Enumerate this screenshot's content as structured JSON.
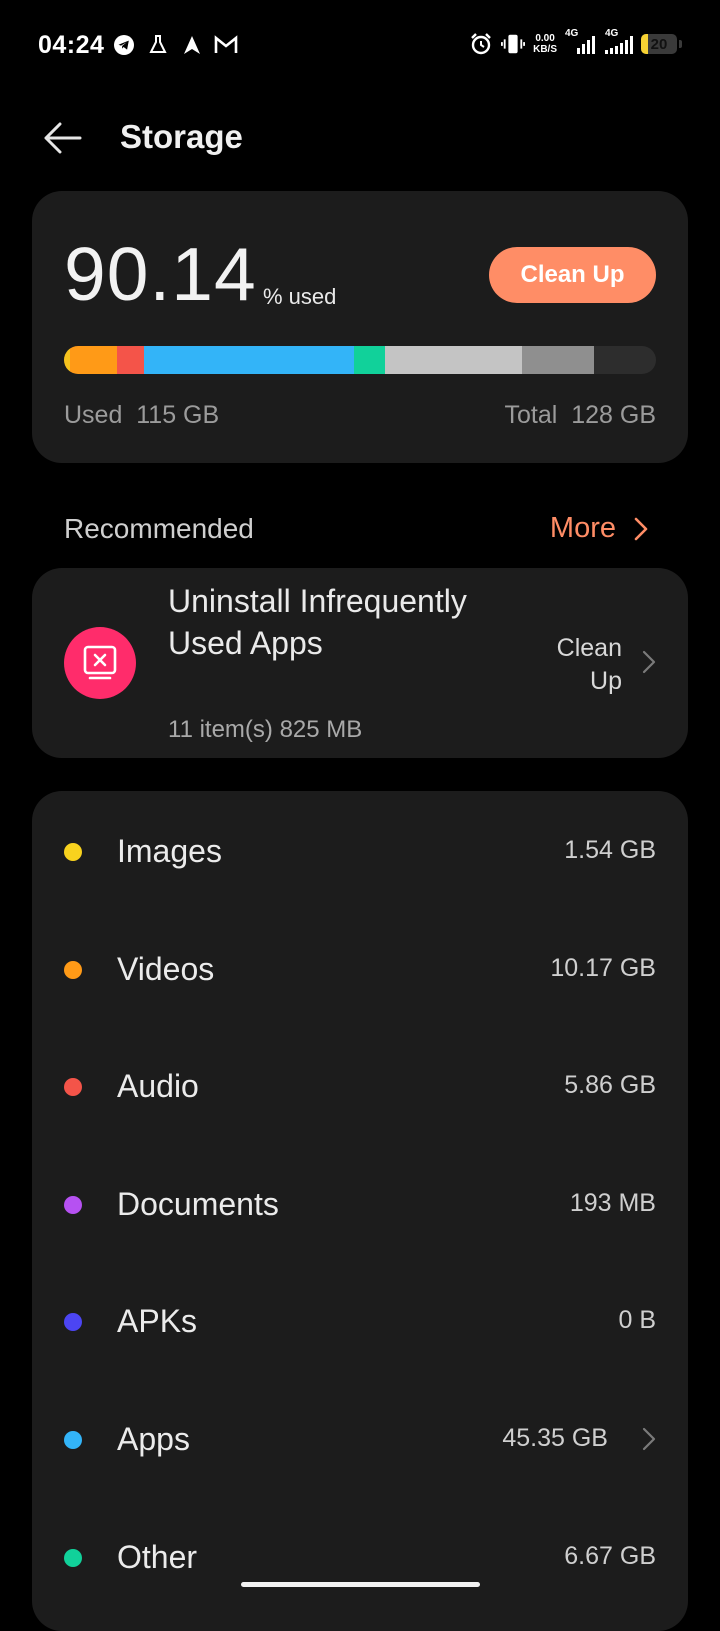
{
  "status_bar": {
    "time": "04:24",
    "net_speed_value": "0.00",
    "net_speed_unit": "KB/S",
    "sim1_label": "4G",
    "sim2_label": "4G",
    "battery_level": "20"
  },
  "header": {
    "title": "Storage"
  },
  "usage": {
    "percent": "90.14",
    "percent_label": "% used",
    "clean_up_label": "Clean Up",
    "used_label": "Used  115 GB",
    "total_label": "Total  128 GB",
    "bar_segments": [
      {
        "name": "images",
        "color": "#f6c21d",
        "fraction": 0.01
      },
      {
        "name": "videos",
        "color": "#ff9a17",
        "fraction": 0.08
      },
      {
        "name": "audio",
        "color": "#f45449",
        "fraction": 0.046
      },
      {
        "name": "apps",
        "color": "#33b4f8",
        "fraction": 0.354
      },
      {
        "name": "other",
        "color": "#11d19a",
        "fraction": 0.052
      },
      {
        "name": "system",
        "color": "#c4c4c4",
        "fraction": 0.232
      },
      {
        "name": "system-2",
        "color": "#8f8f8f",
        "fraction": 0.122
      }
    ]
  },
  "recommended": {
    "heading": "Recommended",
    "more_label": "More",
    "item": {
      "title": "Uninstall Infrequently Used Apps",
      "subtitle": "11 item(s) 825 MB",
      "action_line1": "Clean",
      "action_line2": "Up",
      "icon": "uninstall-app-icon"
    }
  },
  "categories": [
    {
      "name": "Images",
      "size": "1.54 GB",
      "color": "#f8d21e"
    },
    {
      "name": "Videos",
      "size": "10.17 GB",
      "color": "#ff9a17"
    },
    {
      "name": "Audio",
      "size": "5.86 GB",
      "color": "#f45449"
    },
    {
      "name": "Documents",
      "size": "193 MB",
      "color": "#b651f2"
    },
    {
      "name": "APKs",
      "size": "0 B",
      "color": "#4c45f3"
    },
    {
      "name": "Apps",
      "size": "45.35 GB",
      "color": "#33b4f8"
    },
    {
      "name": "Other",
      "size": "6.67 GB",
      "color": "#11d19a"
    }
  ]
}
